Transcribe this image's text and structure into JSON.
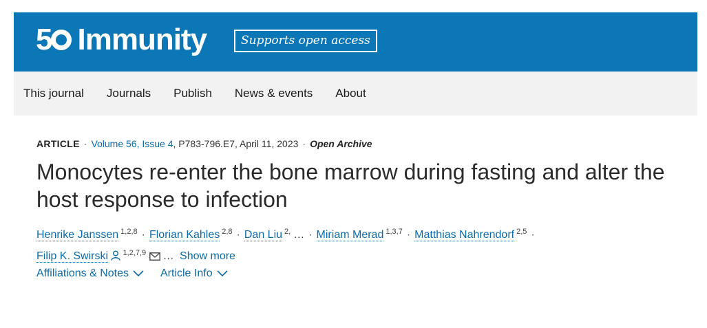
{
  "header": {
    "logo_number": "50",
    "journal_name": "Immunity",
    "badge": "Supports open access",
    "brand_color": "#0b77b7"
  },
  "nav": {
    "items": [
      "This journal",
      "Journals",
      "Publish",
      "News & events",
      "About"
    ]
  },
  "article": {
    "type": "ARTICLE",
    "issue": "Volume 56, Issue 4",
    "pages_date": ", P783-796.E7, April 11, 2023",
    "access": "Open Archive",
    "title": "Monocytes re-enter the bone marrow during fasting and alter the host response to infection",
    "authors": [
      {
        "name": "Henrike Janssen",
        "sup": "1,2,8"
      },
      {
        "name": "Florian Kahles",
        "sup": "2,8"
      },
      {
        "name": "Dan Liu",
        "sup": "2,"
      },
      {
        "name": "Miriam Merad",
        "sup": "1,3,7"
      },
      {
        "name": "Matthias Nahrendorf",
        "sup": "2,5"
      },
      {
        "name": "Filip K. Swirski",
        "sup": "1,2,7,9"
      }
    ],
    "ellipsis": "…",
    "show_more": "Show more",
    "links": {
      "affiliations": "Affiliations & Notes",
      "article_info": "Article Info"
    }
  }
}
